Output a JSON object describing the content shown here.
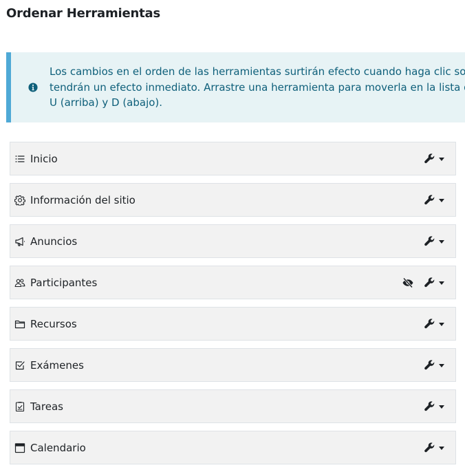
{
  "page": {
    "title": "Ordenar Herramientas"
  },
  "alert": {
    "icon": "info-icon",
    "lines": [
      "Los cambios en el orden de las herramientas surtirán efecto cuando haga clic sobre",
      "tendrán un efecto inmediato. Arrastre una herramienta para moverla en la lista de d",
      "U (arriba) y D (abajo)."
    ],
    "colors": {
      "background": "#e7f3f5",
      "border": "#4fa9d6",
      "text": "#0e5f7a"
    }
  },
  "tools": [
    {
      "label": "Inicio",
      "icon": "list-icon",
      "hidden": false
    },
    {
      "label": "Información del sitio",
      "icon": "gear-icon",
      "hidden": false
    },
    {
      "label": "Anuncios",
      "icon": "megaphone-icon",
      "hidden": false
    },
    {
      "label": "Participantes",
      "icon": "users-icon",
      "hidden": true
    },
    {
      "label": "Recursos",
      "icon": "folder-icon",
      "hidden": false
    },
    {
      "label": "Exámenes",
      "icon": "checkbox-icon",
      "hidden": false
    },
    {
      "label": "Tareas",
      "icon": "clipboard-check-icon",
      "hidden": false
    },
    {
      "label": "Calendario",
      "icon": "calendar-icon",
      "hidden": false
    }
  ]
}
